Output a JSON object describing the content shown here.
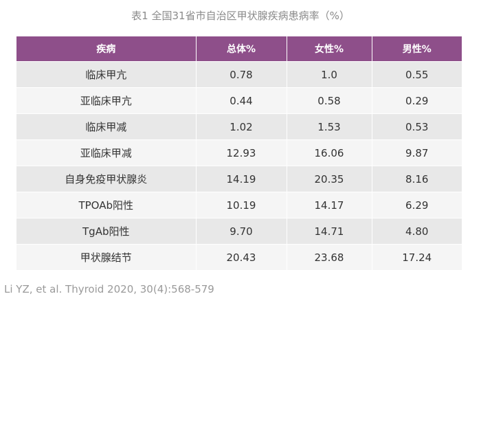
{
  "caption": "表1 全国31省市自治区甲状腺疾病患病率（%）",
  "table": {
    "headers": [
      "疾病",
      "总体%",
      "女性%",
      "男性%"
    ],
    "rows": [
      [
        "临床甲亢",
        "0.78",
        "1.0",
        "0.55"
      ],
      [
        "亚临床甲亢",
        "0.44",
        "0.58",
        "0.29"
      ],
      [
        "临床甲减",
        "1.02",
        "1.53",
        "0.53"
      ],
      [
        "亚临床甲减",
        "12.93",
        "16.06",
        "9.87"
      ],
      [
        "自身免疫甲状腺炎",
        "14.19",
        "20.35",
        "8.16"
      ],
      [
        "TPOAb阳性",
        "10.19",
        "14.17",
        "6.29"
      ],
      [
        "TgAb阳性",
        "9.70",
        "14.71",
        "4.80"
      ],
      [
        "甲状腺结节",
        "20.43",
        "23.68",
        "17.24"
      ]
    ]
  },
  "citation": "Li YZ, et al. Thyroid 2020, 30(4):568-579",
  "colors": {
    "header_bg": "#8e4f8a",
    "header_text": "#ffffff",
    "row_odd": "#e8e8e8",
    "row_even": "#f5f5f5"
  }
}
